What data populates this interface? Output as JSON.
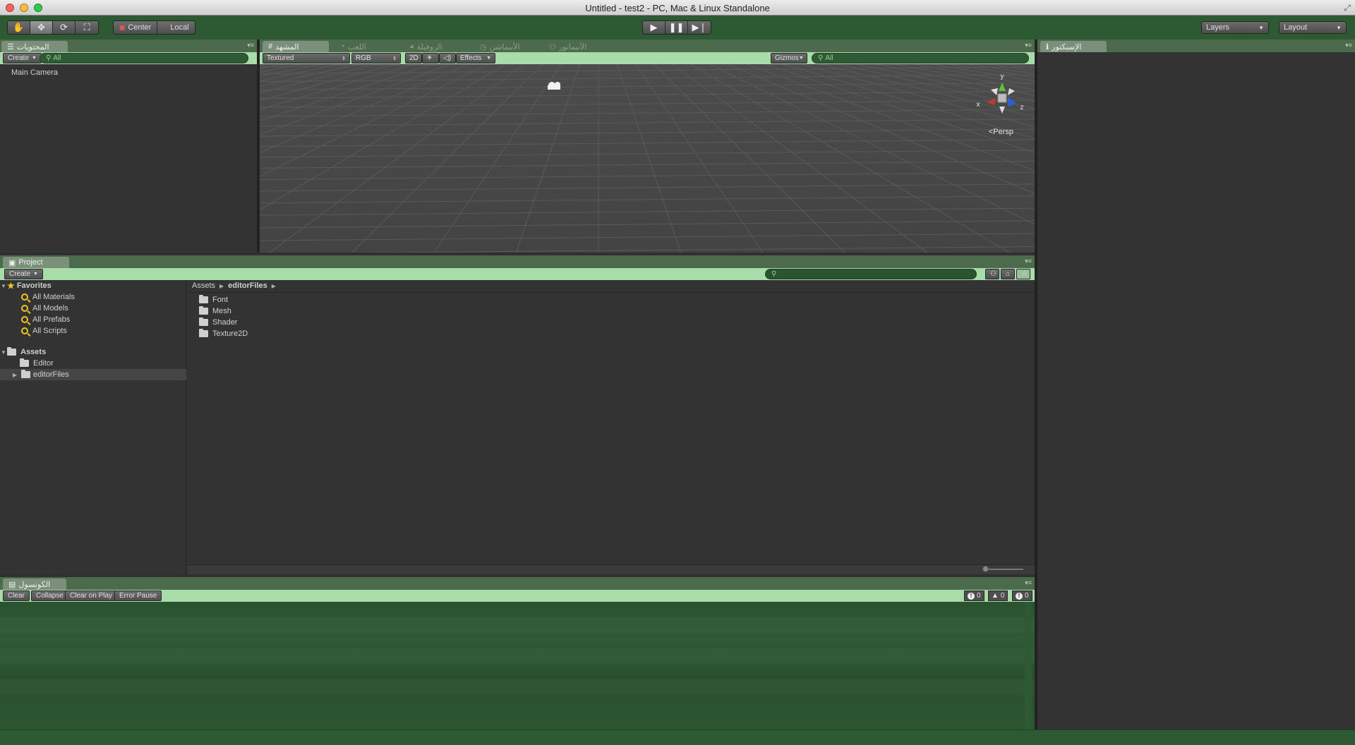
{
  "window": {
    "title": "Untitled - test2 - PC, Mac & Linux Standalone"
  },
  "toolbar": {
    "tools": [
      "hand-icon",
      "move-icon",
      "rotate-icon",
      "scale-icon"
    ],
    "pivot": {
      "center_label": "Center",
      "local_label": "Local"
    },
    "playback": [
      "play-icon",
      "pause-icon",
      "step-icon"
    ],
    "layers_label": "Layers",
    "layout_label": "Layout"
  },
  "hierarchy": {
    "tab_label": "المحتويات",
    "create_label": "Create",
    "search_placeholder": "All",
    "items": [
      "Main Camera"
    ]
  },
  "scene": {
    "tabs": [
      {
        "label": "المشهد",
        "icon": "grid-icon"
      },
      {
        "label": "اللعب",
        "icon": "pacman-icon"
      },
      {
        "label": "الروفيلة",
        "icon": "shop-icon"
      },
      {
        "label": "الأنيماشن",
        "icon": "clock-icon"
      },
      {
        "label": "الأنيماتور",
        "icon": "animator-icon"
      }
    ],
    "shading_label": "Textured",
    "render_label": "RGB",
    "mode_2d_label": "2D",
    "effects_label": "Effects",
    "gizmos_label": "Gizmos",
    "search_placeholder": "All",
    "persp_label": "Persp",
    "axis_labels": {
      "x": "x",
      "y": "y",
      "z": "z"
    },
    "colors": {
      "x_axis": "#c0392b",
      "y_axis": "#5cc43a",
      "z_axis": "#2d5fd8"
    }
  },
  "inspector": {
    "tab_label": "الإسبكتور"
  },
  "project": {
    "tab_label": "Project",
    "create_label": "Create",
    "favorites_label": "Favorites",
    "favorites": [
      "All Materials",
      "All Models",
      "All Prefabs",
      "All Scripts"
    ],
    "assets_label": "Assets",
    "asset_children": [
      "Editor",
      "editorFiles"
    ],
    "breadcrumb": [
      "Assets",
      "editorFiles"
    ],
    "folder_items": [
      "Font",
      "Mesh",
      "Shader",
      "Texture2D"
    ]
  },
  "console": {
    "tab_label": "الكونسول",
    "buttons": [
      "Clear",
      "Collapse",
      "Clear on Play",
      "Error Pause"
    ],
    "counts": {
      "errors": "0",
      "warnings": "0",
      "messages": "0"
    }
  },
  "colors": {
    "toolbar_bg": "#2d5a32",
    "subbar_bg": "#a8dca8",
    "panel_bg": "#333333"
  }
}
